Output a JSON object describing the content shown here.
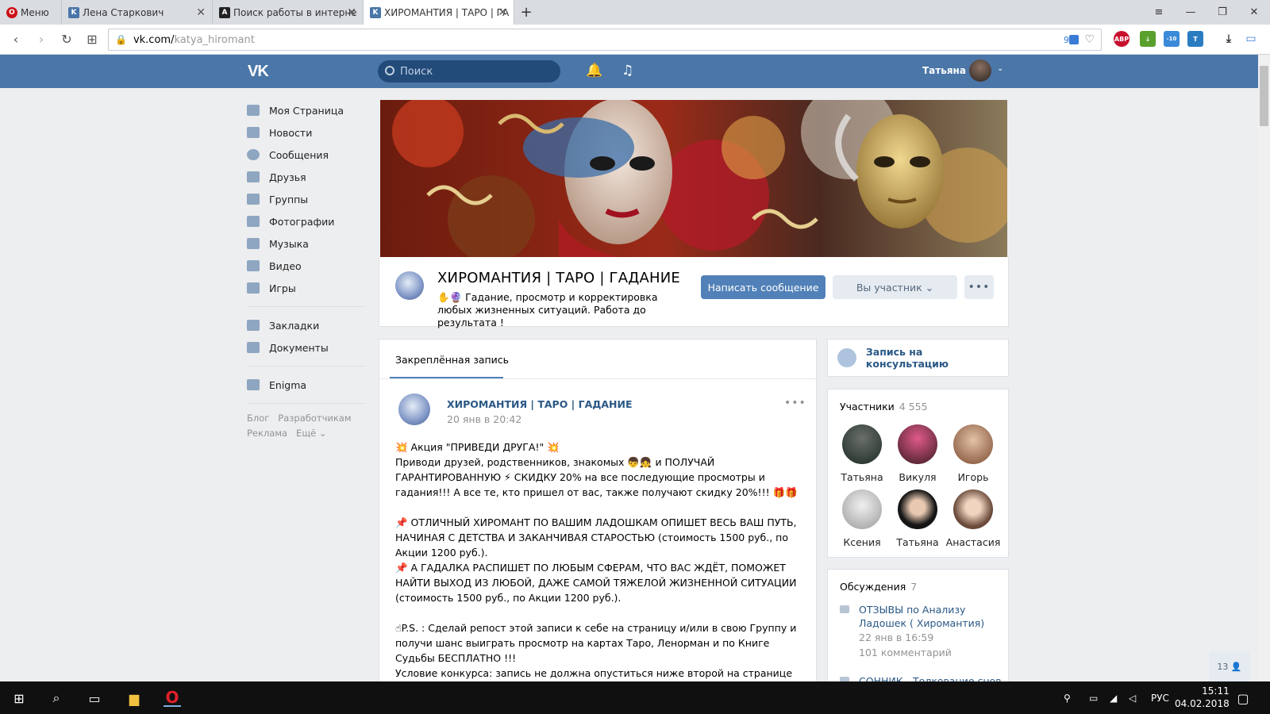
{
  "browser": {
    "menu_label": "Меню",
    "tabs": [
      {
        "title": "Лена Старкович"
      },
      {
        "title": "Поиск работы в интерне"
      },
      {
        "title": "ХИРОМАНТИЯ | ТАРО | ГА"
      }
    ],
    "new_tab": "+",
    "url_domain": "vk.com/",
    "url_path": "katya_hiromant",
    "badge_count": "9",
    "ext_abp": "ABP",
    "ext_count": "-10"
  },
  "vk_header": {
    "logo": "VK",
    "search_placeholder": "Поиск",
    "user_name": "Татьяна"
  },
  "sidebar": {
    "items": [
      {
        "label": "Моя Страница"
      },
      {
        "label": "Новости"
      },
      {
        "label": "Сообщения"
      },
      {
        "label": "Друзья"
      },
      {
        "label": "Группы"
      },
      {
        "label": "Фотографии"
      },
      {
        "label": "Музыка"
      },
      {
        "label": "Видео"
      },
      {
        "label": "Игры"
      }
    ],
    "items2": [
      {
        "label": "Закладки"
      },
      {
        "label": "Документы"
      }
    ],
    "items3": [
      {
        "label": "Enigma"
      }
    ],
    "footer": {
      "blog": "Блог",
      "dev": "Разработчикам",
      "ads": "Реклама",
      "more": "Ещё"
    }
  },
  "group": {
    "title": "ХИРОМАНТИЯ | ТАРО | ГАДАНИЕ",
    "status": "✋🔮 Гадание, просмотр и корректировка любых жизненных ситуаций. Работа до результата !",
    "btn_message": "Написать сообщение",
    "btn_member": "Вы участник",
    "btn_more": "•••"
  },
  "wall": {
    "tab_pinned": "Закреплённая запись",
    "post": {
      "author": "ХИРОМАНТИЯ | ТАРО | ГАДАНИЕ",
      "date": "20 янв в 20:42",
      "lines": [
        "💥 Акция \"ПРИВЕДИ ДРУГА!\" 💥",
        "Приводи друзей, родственников, знакомых 👦👧 и ПОЛУЧАЙ ГАРАНТИРОВАННУЮ ⚡ СКИДКУ 20% на все последующие просмотры и гадания!!! А все те, кто пришел от вас, также получают скидку 20%!!! 🎁🎁",
        "📌 ОТЛИЧНЫЙ ХИРОМАНТ ПО ВАШИМ ЛАДОШКАМ ОПИШЕТ ВЕСЬ ВАШ ПУТЬ, НАЧИНАЯ С ДЕТСТВА И ЗАКАНЧИВАЯ СТАРОСТЬЮ (стоимость 1500 руб., по Акции 1200 руб.).",
        "📌 А ГАДАЛКА РАСПИШЕТ ПО ЛЮБЫМ СФЕРАМ, ЧТО ВАС ЖДЁТ, ПОМОЖЕТ НАЙТИ ВЫХОД ИЗ ЛЮБОЙ, ДАЖЕ САМОЙ ТЯЖЕЛОЙ ЖИЗНЕННОЙ СИТУАЦИИ (стоимость 1500 руб., по Акции 1200 руб.).",
        "☝P.S. : Сделай репост этой записи к себе на страницу и/или в свою Группу и получи шанс выиграть просмотр на картах Таро, Ленорман и по Книге Судьбы БЕСПЛАТНО !!!",
        "Условие конкурса: запись не должна опуститься ниже второй на странице до"
      ]
    }
  },
  "right": {
    "consult_label": "Запись на консультацию",
    "members_title": "Участники",
    "members_count": "4 555",
    "members": [
      {
        "name": "Татьяна"
      },
      {
        "name": "Викуля"
      },
      {
        "name": "Игорь"
      },
      {
        "name": "Ксения"
      },
      {
        "name": "Татьяна"
      },
      {
        "name": "Анастасия"
      }
    ],
    "discuss_title": "Обсуждения",
    "discuss_count": "7",
    "topics": [
      {
        "title": "ОТЗЫВЫ по Анализу Ладошек ( Хиромантия)",
        "date": "22 янв в 16:59",
        "comments": "101 комментарий"
      },
      {
        "title": "СОННИК - Толкование снов"
      }
    ]
  },
  "online_counter": "13",
  "taskbar": {
    "lang": "РУС",
    "time": "15:11",
    "date": "04.02.2018"
  }
}
